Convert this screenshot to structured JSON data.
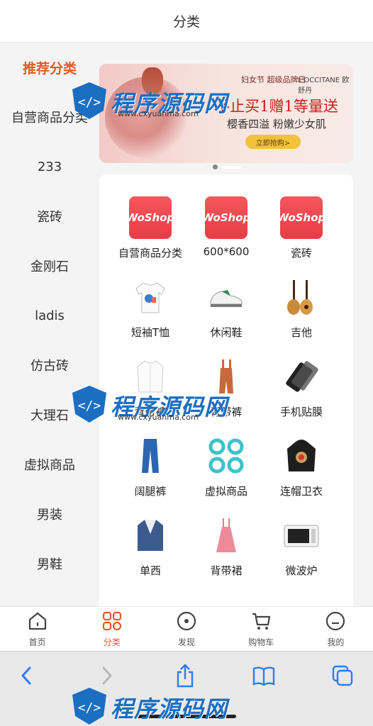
{
  "header": {
    "title": "分类"
  },
  "sidebar": {
    "items": [
      {
        "label": "推荐分类",
        "active": true
      },
      {
        "label": "自营商品分类"
      },
      {
        "label": "233"
      },
      {
        "label": "瓷砖"
      },
      {
        "label": "金刚石"
      },
      {
        "label": "ladis"
      },
      {
        "label": "仿古砖"
      },
      {
        "label": "大理石"
      },
      {
        "label": "虚拟商品"
      },
      {
        "label": "男装"
      },
      {
        "label": "男鞋"
      }
    ]
  },
  "banner": {
    "brand_left": "妇女节 超级品牌日",
    "brand_right": "L'OCCITANE 欧舒丹",
    "headline": "不止买1赠1等量送",
    "subline": "樱香四溢 粉嫩少女肌",
    "button": "立即抢购>"
  },
  "categories": [
    {
      "label": "自营商品分类",
      "icon": "woshop-logo",
      "logo_text": "WoShop"
    },
    {
      "label": "600*600",
      "icon": "woshop-logo",
      "logo_text": "WoShop"
    },
    {
      "label": "瓷砖",
      "icon": "woshop-logo",
      "logo_text": "WoShop"
    },
    {
      "label": "短袖T恤",
      "icon": "tshirt-icon"
    },
    {
      "label": "休闲鞋",
      "icon": "sneaker-icon"
    },
    {
      "label": "吉他",
      "icon": "guitar-icon"
    },
    {
      "label": "背带裤",
      "icon": "shirt-icon"
    },
    {
      "label": "背带裤",
      "icon": "overalls-icon"
    },
    {
      "label": "手机贴膜",
      "icon": "phone-film-icon"
    },
    {
      "label": "阔腿裤",
      "icon": "pants-icon"
    },
    {
      "label": "虚拟商品",
      "icon": "clover-icon"
    },
    {
      "label": "连帽卫衣",
      "icon": "hoodie-icon"
    },
    {
      "label": "单西",
      "icon": "blazer-icon"
    },
    {
      "label": "背带裙",
      "icon": "dress-icon"
    },
    {
      "label": "微波炉",
      "icon": "microwave-icon"
    }
  ],
  "tabbar": {
    "tabs": [
      {
        "label": "首页",
        "icon": "home-icon"
      },
      {
        "label": "分类",
        "icon": "category-icon",
        "active": true
      },
      {
        "label": "发现",
        "icon": "discover-icon"
      },
      {
        "label": "购物车",
        "icon": "cart-icon"
      },
      {
        "label": "我的",
        "icon": "profile-icon"
      }
    ]
  },
  "browser": {
    "buttons": [
      "back-icon",
      "forward-icon",
      "share-icon",
      "bookmarks-icon",
      "tabs-icon"
    ]
  },
  "watermark": {
    "text": "程序源码网",
    "url": "www.cxyuanma.com"
  },
  "colors": {
    "accent": "#e25a2a",
    "ios_blue": "#2d7cf6",
    "woshop_red": "#ef4a50"
  }
}
